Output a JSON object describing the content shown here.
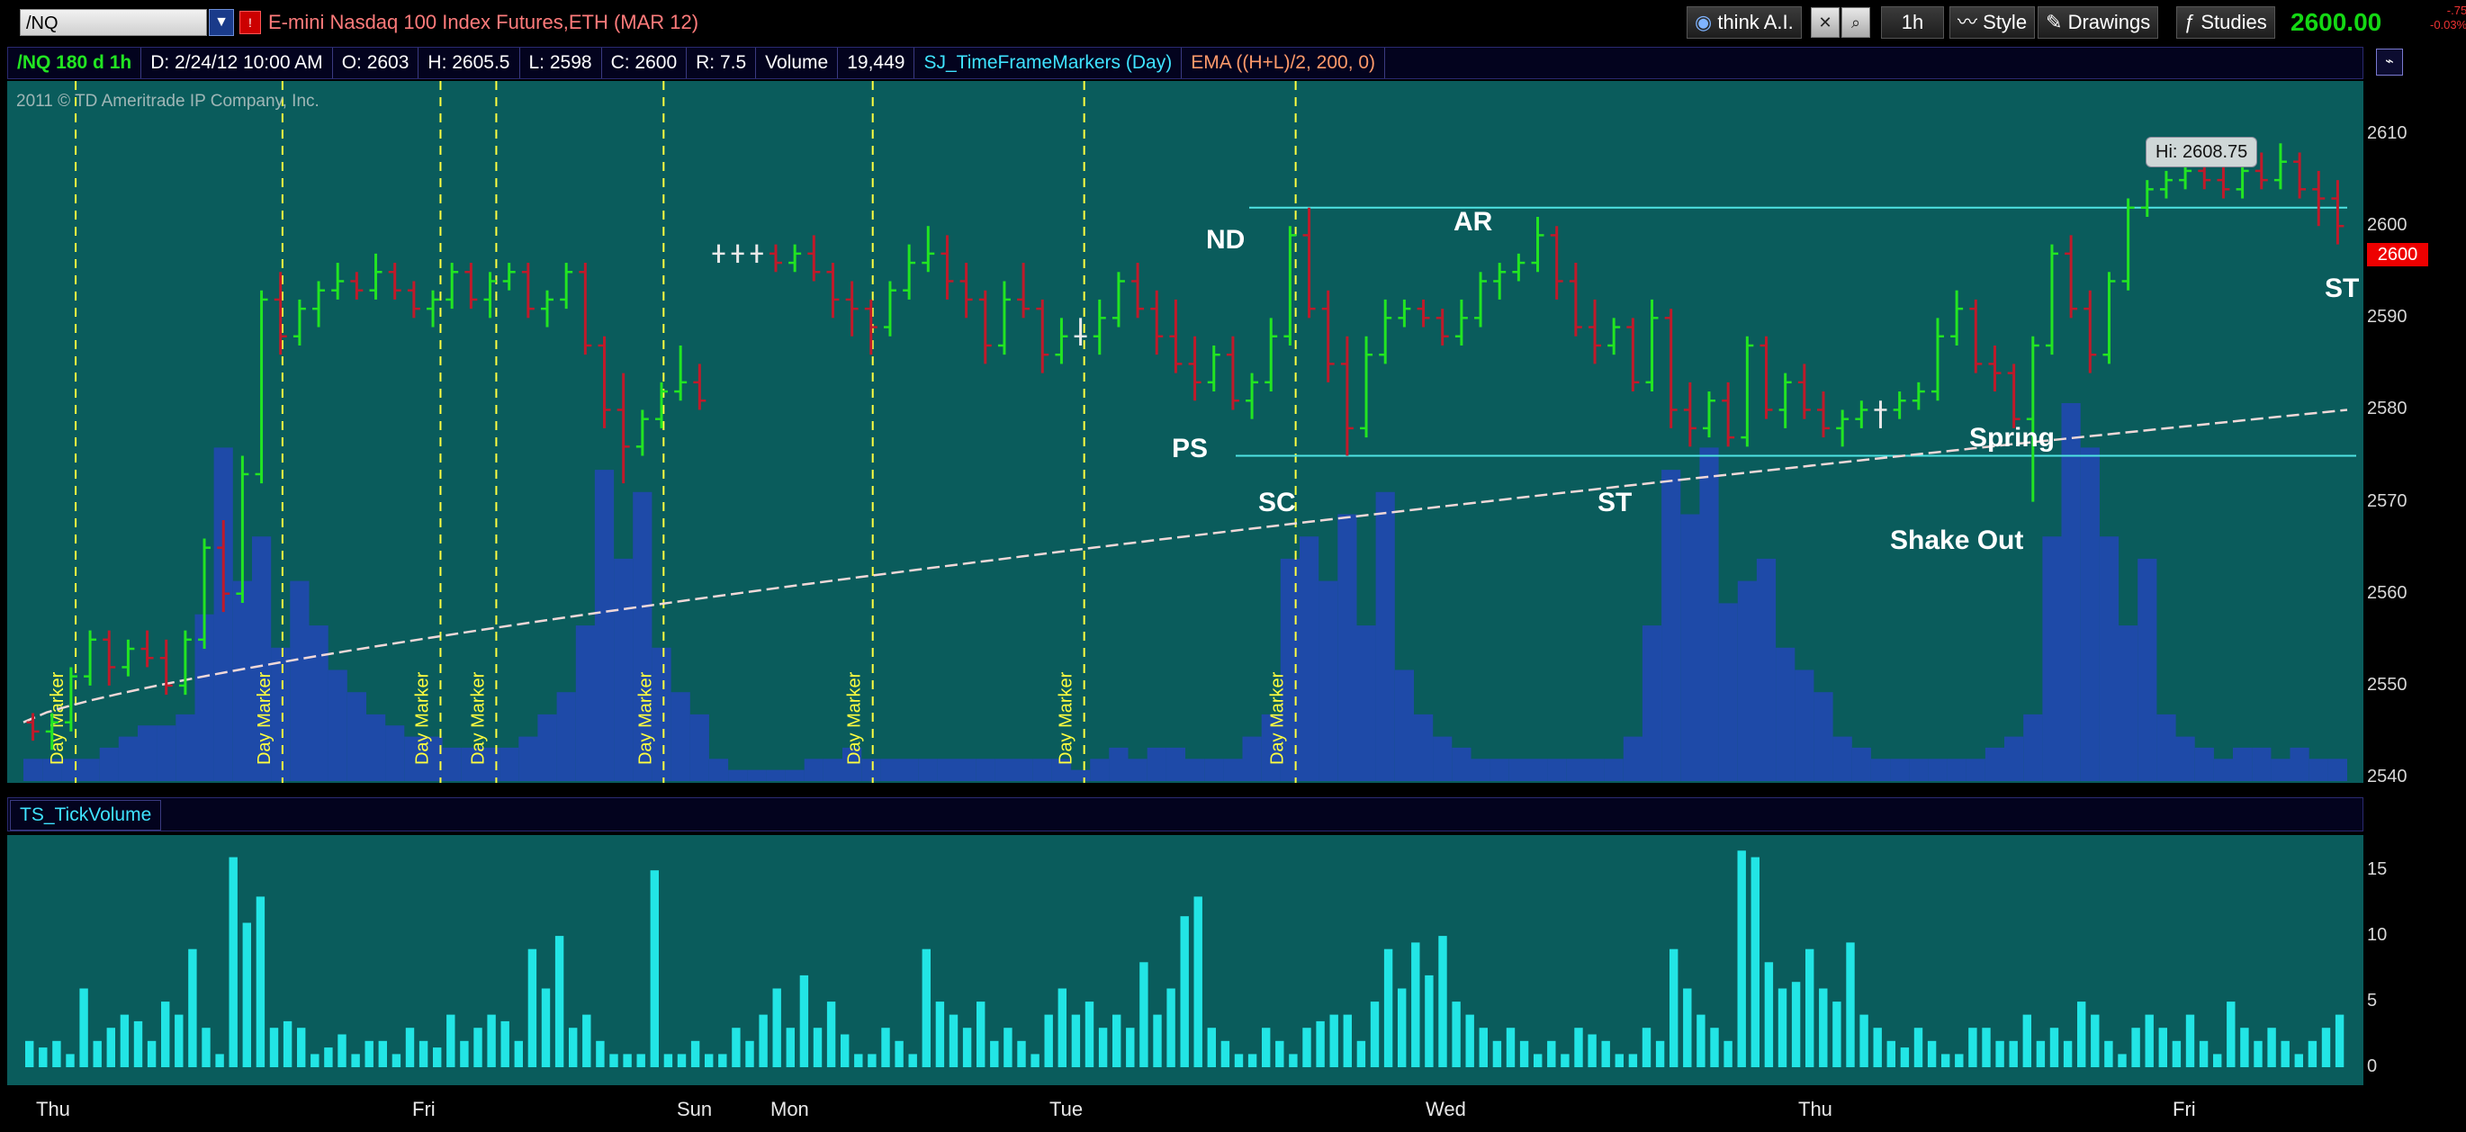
{
  "toolbar": {
    "symbol": "/NQ",
    "description": "E-mini Nasdaq 100 Index Futures,ETH (MAR 12)",
    "think_ai": "think A.I.",
    "timeframe": "1h",
    "style": "Style",
    "drawings": "Drawings",
    "studies": "Studies",
    "last_price": "2600.00",
    "change": "-.75",
    "change_pct": "-0.03%"
  },
  "infobar": {
    "title": "/NQ 180 d 1h",
    "date": "D: 2/24/12 10:00 AM",
    "open": "O: 2603",
    "high": "H: 2605.5",
    "low": "L: 2598",
    "close": "C: 2600",
    "range": "R: 7.5",
    "volume_label": "Volume",
    "volume_value": "19,449",
    "study1": "SJ_TimeFrameMarkers (Day)",
    "study2": "EMA ((H+L)/2, 200, 0)"
  },
  "copyright": "2011 © TD Ameritrade IP Company, Inc.",
  "annotations": {
    "nd": "ND",
    "ar": "AR",
    "ps": "PS",
    "sc": "SC",
    "st1": "ST",
    "st2": "ST",
    "shakeout": "Shake Out",
    "spring": "Spring",
    "hi": "Hi: 2608.75"
  },
  "last_badge": "2600",
  "lower_pane_title": "TS_TickVolume",
  "day_marker_label": "Day Marker",
  "day_labels": [
    "Thu",
    "Fri",
    "Sun",
    "Mon",
    "Tue",
    "Wed",
    "Thu",
    "Fri"
  ],
  "y_axis_price": [
    "2610",
    "2600",
    "2590",
    "2580",
    "2570",
    "2560",
    "2550",
    "2540"
  ],
  "y_axis_tick": [
    "15",
    "10",
    "5",
    "0"
  ],
  "colors": {
    "panel": "#0a5c5c",
    "up": "#22e522",
    "down": "#c01a2a",
    "volume": "#1e4aa8",
    "tick": "#22e5e5",
    "marker": "#ffff40"
  },
  "chart_data": {
    "type": "bar",
    "price_ylim": [
      2540,
      2615
    ],
    "tick_ylim": [
      0,
      17
    ],
    "resistance": 2602,
    "support": 2575,
    "ohlc": [
      [
        2546,
        2547,
        2544,
        2545
      ],
      [
        2545,
        2547,
        2543,
        2546
      ],
      [
        2546,
        2552,
        2545,
        2551
      ],
      [
        2551,
        2556,
        2550,
        2555
      ],
      [
        2555,
        2556,
        2550,
        2552
      ],
      [
        2552,
        2555,
        2551,
        2554
      ],
      [
        2554,
        2556,
        2552,
        2553
      ],
      [
        2553,
        2555,
        2549,
        2550
      ],
      [
        2550,
        2556,
        2549,
        2555
      ],
      [
        2555,
        2566,
        2554,
        2565
      ],
      [
        2565,
        2568,
        2558,
        2560
      ],
      [
        2560,
        2575,
        2559,
        2573
      ],
      [
        2573,
        2593,
        2572,
        2592
      ],
      [
        2592,
        2595,
        2586,
        2588
      ],
      [
        2588,
        2592,
        2587,
        2591
      ],
      [
        2591,
        2594,
        2589,
        2593
      ],
      [
        2593,
        2596,
        2592,
        2594
      ],
      [
        2594,
        2595,
        2592,
        2593
      ],
      [
        2593,
        2597,
        2592,
        2595
      ],
      [
        2595,
        2596,
        2592,
        2593
      ],
      [
        2593,
        2594,
        2590,
        2591
      ],
      [
        2591,
        2593,
        2589,
        2592
      ],
      [
        2592,
        2596,
        2591,
        2595
      ],
      [
        2595,
        2596,
        2591,
        2592
      ],
      [
        2592,
        2595,
        2590,
        2594
      ],
      [
        2594,
        2596,
        2593,
        2595
      ],
      [
        2595,
        2596,
        2590,
        2591
      ],
      [
        2591,
        2593,
        2589,
        2592
      ],
      [
        2592,
        2596,
        2591,
        2595
      ],
      [
        2595,
        2596,
        2586,
        2587
      ],
      [
        2587,
        2588,
        2578,
        2580
      ],
      [
        2580,
        2584,
        2572,
        2576
      ],
      [
        2576,
        2580,
        2575,
        2579
      ],
      [
        2579,
        2583,
        2578,
        2582
      ],
      [
        2582,
        2587,
        2581,
        2583
      ],
      [
        2583,
        2585,
        2580,
        2581
      ],
      [
        2597,
        2598,
        2596,
        2597
      ],
      [
        2597,
        2598,
        2596,
        2597
      ],
      [
        2597,
        2598,
        2596,
        2597
      ],
      [
        2597,
        2598,
        2595,
        2596
      ],
      [
        2596,
        2598,
        2595,
        2597
      ],
      [
        2597,
        2599,
        2594,
        2595
      ],
      [
        2595,
        2596,
        2590,
        2592
      ],
      [
        2592,
        2594,
        2588,
        2591
      ],
      [
        2591,
        2592,
        2586,
        2589
      ],
      [
        2589,
        2594,
        2588,
        2593
      ],
      [
        2593,
        2598,
        2592,
        2596
      ],
      [
        2596,
        2600,
        2595,
        2597
      ],
      [
        2597,
        2599,
        2592,
        2594
      ],
      [
        2594,
        2596,
        2590,
        2592
      ],
      [
        2592,
        2593,
        2585,
        2587
      ],
      [
        2587,
        2594,
        2586,
        2592
      ],
      [
        2592,
        2596,
        2590,
        2591
      ],
      [
        2591,
        2592,
        2584,
        2586
      ],
      [
        2586,
        2590,
        2585,
        2588
      ],
      [
        2588,
        2590,
        2587,
        2588
      ],
      [
        2588,
        2592,
        2586,
        2590
      ],
      [
        2590,
        2595,
        2589,
        2594
      ],
      [
        2594,
        2596,
        2590,
        2591
      ],
      [
        2591,
        2593,
        2586,
        2588
      ],
      [
        2588,
        2592,
        2584,
        2585
      ],
      [
        2585,
        2588,
        2581,
        2583
      ],
      [
        2583,
        2587,
        2582,
        2586
      ],
      [
        2586,
        2588,
        2580,
        2581
      ],
      [
        2581,
        2584,
        2579,
        2583
      ],
      [
        2583,
        2590,
        2582,
        2588
      ],
      [
        2588,
        2600,
        2587,
        2599
      ],
      [
        2599,
        2602,
        2590,
        2591
      ],
      [
        2591,
        2593,
        2583,
        2585
      ],
      [
        2585,
        2588,
        2575,
        2578
      ],
      [
        2578,
        2588,
        2577,
        2586
      ],
      [
        2586,
        2592,
        2585,
        2590
      ],
      [
        2590,
        2592,
        2589,
        2591
      ],
      [
        2591,
        2592,
        2589,
        2590
      ],
      [
        2590,
        2591,
        2587,
        2588
      ],
      [
        2588,
        2592,
        2587,
        2590
      ],
      [
        2590,
        2595,
        2589,
        2594
      ],
      [
        2594,
        2596,
        2592,
        2595
      ],
      [
        2595,
        2597,
        2594,
        2596
      ],
      [
        2596,
        2601,
        2595,
        2599
      ],
      [
        2599,
        2600,
        2592,
        2594
      ],
      [
        2594,
        2596,
        2588,
        2589
      ],
      [
        2589,
        2592,
        2585,
        2587
      ],
      [
        2587,
        2590,
        2586,
        2589
      ],
      [
        2589,
        2590,
        2582,
        2583
      ],
      [
        2583,
        2592,
        2582,
        2590
      ],
      [
        2590,
        2591,
        2578,
        2580
      ],
      [
        2580,
        2583,
        2576,
        2578
      ],
      [
        2578,
        2582,
        2577,
        2581
      ],
      [
        2581,
        2583,
        2576,
        2577
      ],
      [
        2577,
        2588,
        2576,
        2587
      ],
      [
        2587,
        2588,
        2579,
        2580
      ],
      [
        2580,
        2584,
        2578,
        2583
      ],
      [
        2583,
        2585,
        2579,
        2580
      ],
      [
        2580,
        2582,
        2577,
        2578
      ],
      [
        2578,
        2580,
        2576,
        2579
      ],
      [
        2579,
        2581,
        2578,
        2580
      ],
      [
        2580,
        2581,
        2578,
        2580
      ],
      [
        2580,
        2582,
        2579,
        2581
      ],
      [
        2581,
        2583,
        2580,
        2582
      ],
      [
        2582,
        2590,
        2581,
        2588
      ],
      [
        2588,
        2593,
        2587,
        2591
      ],
      [
        2591,
        2592,
        2584,
        2585
      ],
      [
        2585,
        2587,
        2582,
        2584
      ],
      [
        2584,
        2585,
        2578,
        2579
      ],
      [
        2579,
        2588,
        2570,
        2587
      ],
      [
        2587,
        2598,
        2586,
        2597
      ],
      [
        2597,
        2599,
        2590,
        2591
      ],
      [
        2591,
        2593,
        2584,
        2586
      ],
      [
        2586,
        2595,
        2585,
        2594
      ],
      [
        2594,
        2603,
        2593,
        2602
      ],
      [
        2602,
        2605,
        2601,
        2604
      ],
      [
        2604,
        2606,
        2603,
        2605
      ],
      [
        2605,
        2607,
        2604,
        2606
      ],
      [
        2606,
        2607,
        2604,
        2605
      ],
      [
        2605,
        2607,
        2603,
        2604
      ],
      [
        2604,
        2607,
        2603,
        2606
      ],
      [
        2606,
        2608,
        2604,
        2605
      ],
      [
        2605,
        2609,
        2604,
        2607
      ],
      [
        2607,
        2608,
        2603,
        2604
      ],
      [
        2604,
        2606,
        2600,
        2603
      ],
      [
        2603,
        2605,
        2598,
        2600
      ]
    ],
    "volume": [
      2,
      2,
      2,
      2,
      3,
      4,
      5,
      5,
      6,
      15,
      30,
      18,
      22,
      12,
      18,
      14,
      10,
      8,
      6,
      5,
      4,
      4,
      3,
      3,
      3,
      3,
      4,
      6,
      8,
      14,
      28,
      20,
      26,
      12,
      8,
      6,
      2,
      1,
      1,
      1,
      1,
      2,
      2,
      3,
      2,
      2,
      2,
      2,
      2,
      2,
      2,
      2,
      2,
      2,
      2,
      1,
      2,
      3,
      2,
      3,
      3,
      2,
      2,
      2,
      4,
      6,
      20,
      22,
      18,
      24,
      14,
      26,
      10,
      6,
      4,
      3,
      2,
      2,
      2,
      2,
      2,
      2,
      2,
      2,
      4,
      14,
      28,
      24,
      30,
      16,
      18,
      20,
      12,
      10,
      8,
      4,
      3,
      2,
      2,
      2,
      2,
      2,
      2,
      3,
      4,
      6,
      22,
      34,
      30,
      22,
      14,
      20,
      6,
      4,
      3,
      2,
      3,
      3,
      2,
      3,
      2,
      2
    ],
    "tick_volume": [
      2,
      1.5,
      2,
      1,
      6,
      2,
      3,
      4,
      3.5,
      2,
      5,
      4,
      9,
      3,
      1,
      16,
      11,
      13,
      3,
      3.5,
      3,
      1,
      1.5,
      2.5,
      1,
      2,
      2,
      1,
      3,
      2,
      1.5,
      4,
      2,
      3,
      4,
      3.5,
      2,
      9,
      6,
      10,
      3,
      4,
      2,
      1,
      1,
      1,
      15,
      1,
      1,
      2,
      1,
      1,
      3,
      2,
      4,
      6,
      3,
      7,
      3,
      5,
      2.5,
      1,
      1,
      3,
      2,
      1,
      9,
      5,
      4,
      3,
      5,
      2,
      3,
      2,
      1,
      4,
      6,
      4,
      5,
      3,
      4,
      3,
      8,
      4,
      6,
      11.5,
      13,
      3,
      2,
      1,
      1,
      3,
      2,
      1,
      3,
      3.5,
      4,
      4,
      2,
      5,
      9,
      6,
      9.5,
      7,
      10,
      5,
      4,
      3,
      2,
      3,
      2,
      1,
      2,
      1,
      3,
      2.5,
      2,
      1,
      1,
      3,
      2,
      9,
      6,
      4,
      3,
      2,
      16.5,
      16,
      8,
      6,
      6.5,
      9,
      6,
      5,
      9.5,
      4,
      3,
      2,
      1.5,
      3,
      2,
      1,
      1,
      3,
      3,
      2,
      2,
      4,
      2,
      3,
      2,
      5,
      4,
      2,
      1,
      3,
      4,
      3,
      2,
      4,
      2,
      1,
      5,
      3,
      2,
      3,
      2,
      1,
      2,
      3,
      4
    ]
  }
}
